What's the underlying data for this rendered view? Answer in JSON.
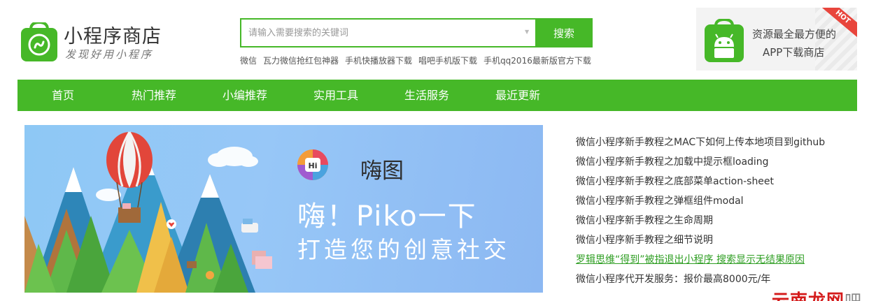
{
  "header": {
    "site_title": "小程序商店",
    "slogan": "发现好用小程序"
  },
  "search": {
    "placeholder": "请输入需要搜索的关键词",
    "button_label": "搜索",
    "hot_words": [
      "微信",
      "瓦力微信抢红包神器",
      "手机快播放器下载",
      "唱吧手机版下载",
      "手机qq2016最新版官方下载"
    ]
  },
  "ad": {
    "line1": "资源最全最方便的",
    "line2": "APP下载商店",
    "badge": "HOT"
  },
  "nav": {
    "items": [
      "首页",
      "热门推荐",
      "小编推荐",
      "实用工具",
      "生活服务",
      "最近更新"
    ]
  },
  "banner": {
    "app_name": "嗨图",
    "app_icon_label": "Hi",
    "slogan_line1": "嗨！Piko一下",
    "slogan_line2": "打造您的创意社交"
  },
  "articles": [
    "微信小程序新手教程之MAC下如何上传本地项目到github",
    "微信小程序新手教程之加载中提示框loading",
    "微信小程序新手教程之底部菜单action-sheet",
    "微信小程序新手教程之弹框组件modal",
    "微信小程序新手教程之生命周期",
    "微信小程序新手教程之细节说明",
    "罗辑思维“得到”被指退出小程序 搜索显示无结果原因",
    "微信小程序代开发服务：报价最高8000元/年"
  ],
  "watermark": {
    "text": "云南龙网",
    "suffix": "吧"
  },
  "colors": {
    "brand_green": "#46b828",
    "link_green": "#2e9e22",
    "banner_blue": "#8ec8f5",
    "hot_red": "#e8453c"
  }
}
